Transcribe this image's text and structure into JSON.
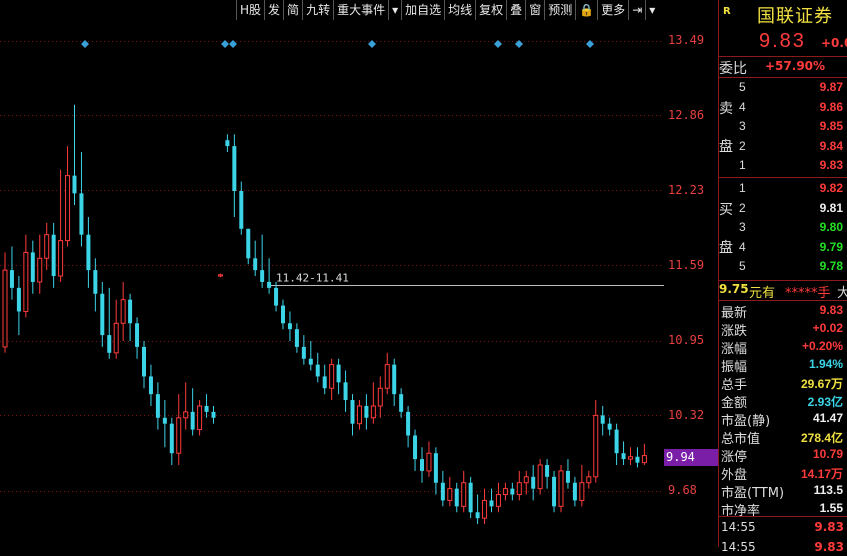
{
  "toolbar": {
    "items": [
      "H股",
      "发",
      "简",
      "九转",
      "重大事件",
      "▾",
      "加自选",
      "均线",
      "复权",
      "叠",
      "窗",
      "预测",
      "🔒",
      "更多",
      "⇥",
      "▾"
    ]
  },
  "axis": {
    "ticks": [
      "13.49",
      "12.86",
      "12.23",
      "11.59",
      "10.95",
      "10.32",
      "9.68"
    ],
    "current_tag": "9.94",
    "annotation": "11.42-11.41"
  },
  "colors": {
    "up": "#ff3b3b",
    "down": "#3cd5e8",
    "diamond": "#3aa0d8"
  },
  "chart_data": {
    "type": "candlestick",
    "candles": [
      [
        10.9,
        11.55,
        11.7,
        10.85
      ],
      [
        11.55,
        11.4,
        11.75,
        11.3
      ],
      [
        11.4,
        11.2,
        11.5,
        11.0
      ],
      [
        11.2,
        11.7,
        11.85,
        11.15
      ],
      [
        11.7,
        11.45,
        11.8,
        11.35
      ],
      [
        11.45,
        11.65,
        11.85,
        11.35
      ],
      [
        11.65,
        11.85,
        11.95,
        11.55
      ],
      [
        11.85,
        11.5,
        11.95,
        11.4
      ],
      [
        11.5,
        11.8,
        12.4,
        11.45
      ],
      [
        11.8,
        12.35,
        12.6,
        11.75
      ],
      [
        12.35,
        12.2,
        12.95,
        12.1
      ],
      [
        12.2,
        11.85,
        12.55,
        11.75
      ],
      [
        11.85,
        11.55,
        12.0,
        11.4
      ],
      [
        11.55,
        11.35,
        11.65,
        11.2
      ],
      [
        11.35,
        11.0,
        11.45,
        10.9
      ],
      [
        11.0,
        10.85,
        11.4,
        10.8
      ],
      [
        10.85,
        11.1,
        11.3,
        10.8
      ],
      [
        11.1,
        11.3,
        11.45,
        10.95
      ],
      [
        11.3,
        11.1,
        11.35,
        10.95
      ],
      [
        11.1,
        10.9,
        11.15,
        10.8
      ],
      [
        10.9,
        10.65,
        10.95,
        10.55
      ],
      [
        10.65,
        10.5,
        10.75,
        10.4
      ],
      [
        10.5,
        10.3,
        10.6,
        10.2
      ],
      [
        10.3,
        10.25,
        10.45,
        10.05
      ],
      [
        10.25,
        10.0,
        10.3,
        9.9
      ],
      [
        10.0,
        10.3,
        10.5,
        9.9
      ],
      [
        10.3,
        10.35,
        10.6,
        10.2
      ],
      [
        10.35,
        10.2,
        10.55,
        10.15
      ],
      [
        10.2,
        10.4,
        10.45,
        10.15
      ],
      [
        10.4,
        10.35,
        10.5,
        10.3
      ],
      [
        10.35,
        10.3,
        10.4,
        10.25
      ],
      [
        11.5,
        11.51,
        11.52,
        11.49
      ],
      [
        12.65,
        12.6,
        12.7,
        12.55
      ],
      [
        12.6,
        12.22,
        12.7,
        12.0
      ],
      [
        12.22,
        11.9,
        12.3,
        11.85
      ],
      [
        11.9,
        11.65,
        11.9,
        11.6
      ],
      [
        11.65,
        11.55,
        11.8,
        11.5
      ],
      [
        11.55,
        11.45,
        11.85,
        11.4
      ],
      [
        11.45,
        11.4,
        11.65,
        11.35
      ],
      [
        11.4,
        11.25,
        11.45,
        11.2
      ],
      [
        11.25,
        11.1,
        11.3,
        11.05
      ],
      [
        11.1,
        11.05,
        11.2,
        10.95
      ],
      [
        11.05,
        10.9,
        11.1,
        10.85
      ],
      [
        10.9,
        10.8,
        11.0,
        10.75
      ],
      [
        10.8,
        10.75,
        10.95,
        10.7
      ],
      [
        10.75,
        10.65,
        10.85,
        10.6
      ],
      [
        10.65,
        10.55,
        10.75,
        10.5
      ],
      [
        10.55,
        10.75,
        10.8,
        10.45
      ],
      [
        10.75,
        10.6,
        10.8,
        10.5
      ],
      [
        10.6,
        10.45,
        10.7,
        10.35
      ],
      [
        10.45,
        10.25,
        10.5,
        10.15
      ],
      [
        10.25,
        10.4,
        10.45,
        10.2
      ],
      [
        10.4,
        10.3,
        10.5,
        10.2
      ],
      [
        10.3,
        10.4,
        10.6,
        10.25
      ],
      [
        10.4,
        10.55,
        10.65,
        10.3
      ],
      [
        10.55,
        10.75,
        10.85,
        10.5
      ],
      [
        10.75,
        10.5,
        10.8,
        10.4
      ],
      [
        10.5,
        10.35,
        10.55,
        10.3
      ],
      [
        10.35,
        10.15,
        10.4,
        10.05
      ],
      [
        10.15,
        9.95,
        10.2,
        9.85
      ],
      [
        9.95,
        9.85,
        10.05,
        9.75
      ],
      [
        9.85,
        10.0,
        10.1,
        9.8
      ],
      [
        10.0,
        9.75,
        10.05,
        9.65
      ],
      [
        9.75,
        9.6,
        9.85,
        9.55
      ],
      [
        9.6,
        9.7,
        9.8,
        9.55
      ],
      [
        9.7,
        9.55,
        9.75,
        9.5
      ],
      [
        9.55,
        9.75,
        9.85,
        9.5
      ],
      [
        9.75,
        9.5,
        9.8,
        9.45
      ],
      [
        9.5,
        9.45,
        9.65,
        9.4
      ],
      [
        9.45,
        9.6,
        9.7,
        9.4
      ],
      [
        9.6,
        9.55,
        9.7,
        9.5
      ],
      [
        9.55,
        9.65,
        9.75,
        9.5
      ],
      [
        9.65,
        9.7,
        9.75,
        9.6
      ],
      [
        9.7,
        9.65,
        9.75,
        9.6
      ],
      [
        9.65,
        9.75,
        9.85,
        9.6
      ],
      [
        9.75,
        9.8,
        9.85,
        9.65
      ],
      [
        9.8,
        9.7,
        9.9,
        9.6
      ],
      [
        9.7,
        9.9,
        9.95,
        9.65
      ],
      [
        9.9,
        9.8,
        9.95,
        9.7
      ],
      [
        9.8,
        9.55,
        9.85,
        9.5
      ],
      [
        9.55,
        9.85,
        9.9,
        9.5
      ],
      [
        9.85,
        9.75,
        9.95,
        9.7
      ],
      [
        9.75,
        9.6,
        9.8,
        9.55
      ],
      [
        9.6,
        9.75,
        9.9,
        9.55
      ],
      [
        9.75,
        9.8,
        9.85,
        9.7
      ],
      [
        9.8,
        10.32,
        10.45,
        9.75
      ],
      [
        10.32,
        10.25,
        10.4,
        10.15
      ],
      [
        10.25,
        10.2,
        10.3,
        10.15
      ],
      [
        10.2,
        10.0,
        10.25,
        9.9
      ],
      [
        10.0,
        9.95,
        10.1,
        9.9
      ],
      [
        9.95,
        9.97,
        10.05,
        9.9
      ],
      [
        9.97,
        9.92,
        10.05,
        9.88
      ],
      [
        9.92,
        9.98,
        10.08,
        9.9
      ]
    ],
    "markers": [
      13.49,
      13.49,
      13.49,
      13.49,
      13.49,
      13.49,
      13.49
    ],
    "ylim": [
      9.5,
      13.65
    ]
  },
  "quote": {
    "r_label": "R",
    "name": "国联证券",
    "price": "9.83",
    "change": "+0.0",
    "commission_ratio_label": "委比",
    "commission_ratio_value": "+57.90%",
    "sell_label": [
      "卖",
      "盘"
    ],
    "buy_label": [
      "买",
      "盘"
    ],
    "sell": [
      {
        "lvl": "5",
        "price": "9.87"
      },
      {
        "lvl": "4",
        "price": "9.86"
      },
      {
        "lvl": "3",
        "price": "9.85"
      },
      {
        "lvl": "2",
        "price": "9.84"
      },
      {
        "lvl": "1",
        "price": "9.83"
      }
    ],
    "buy": [
      {
        "lvl": "1",
        "price": "9.82"
      },
      {
        "lvl": "2",
        "price": "9.81"
      },
      {
        "lvl": "3",
        "price": "9.80"
      },
      {
        "lvl": "4",
        "price": "9.79"
      },
      {
        "lvl": "5",
        "price": "9.78"
      }
    ],
    "buy_colors": [
      "red",
      "wht",
      "grn",
      "grn",
      "grn"
    ],
    "ticker_price": "9.75",
    "ticker_text1": "元有",
    "ticker_text2": "*****手",
    "ticker_text3": "大",
    "stats": [
      {
        "label": "最新",
        "value": "9.83",
        "color": "red"
      },
      {
        "label": "涨跌",
        "value": "+0.02",
        "color": "red"
      },
      {
        "label": "涨幅",
        "value": "+0.20%",
        "color": "red"
      },
      {
        "label": "振幅",
        "value": "1.94%",
        "color": "cyan"
      },
      {
        "label": "总手",
        "value": "29.67万",
        "color": "yel"
      },
      {
        "label": "金额",
        "value": "2.93亿",
        "color": "cyan"
      },
      {
        "label": "市盈(静)",
        "value": "41.47",
        "color": "wht"
      },
      {
        "label": "总市值",
        "value": "278.4亿",
        "color": "yel"
      },
      {
        "label": "涨停",
        "value": "10.79",
        "color": "red"
      },
      {
        "label": "外盘",
        "value": "14.17万",
        "color": "red"
      },
      {
        "label": "市盈(TTM)",
        "value": "113.5",
        "color": "wht"
      },
      {
        "label": "市净率",
        "value": "1.55",
        "color": "wht"
      }
    ],
    "time": "14:55",
    "time_price": "9.83",
    "time2": "14:55",
    "time2_price": "9.83"
  }
}
